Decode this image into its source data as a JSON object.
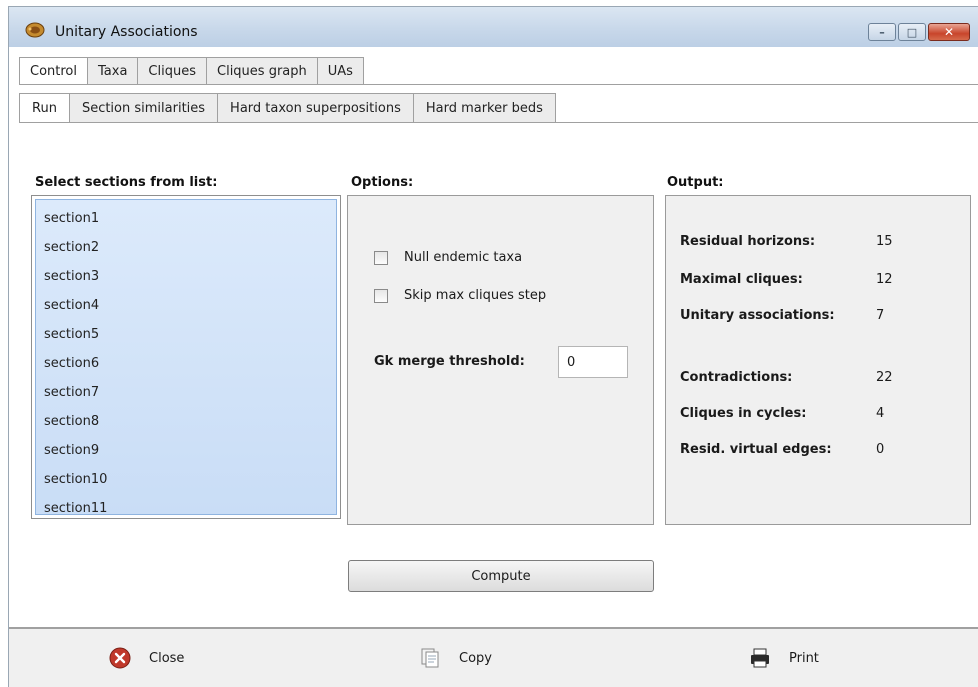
{
  "window": {
    "title": "Unitary Associations"
  },
  "tabs_top": [
    "Control",
    "Taxa",
    "Cliques",
    "Cliques graph",
    "UAs"
  ],
  "tabs_sub": [
    "Run",
    "Section similarities",
    "Hard taxon superpositions",
    "Hard marker beds"
  ],
  "sections": {
    "label": "Select sections from list:",
    "items": [
      "section1",
      "section2",
      "section3",
      "section4",
      "section5",
      "section6",
      "section7",
      "section8",
      "section9",
      "section10",
      "section11"
    ]
  },
  "options": {
    "label": "Options:",
    "null_endemic": "Null endemic taxa",
    "skip_max": "Skip max cliques step",
    "gk_label": "Gk merge threshold:",
    "gk_value": "0"
  },
  "output": {
    "label": "Output:",
    "rows": [
      {
        "label": "Residual horizons:",
        "value": "15"
      },
      {
        "label": "Maximal cliques:",
        "value": "12"
      },
      {
        "label": "Unitary associations:",
        "value": "7"
      },
      {
        "label": "Contradictions:",
        "value": "22"
      },
      {
        "label": "Cliques in cycles:",
        "value": "4"
      },
      {
        "label": "Resid. virtual edges:",
        "value": "0"
      }
    ]
  },
  "compute_label": "Compute",
  "bottom": {
    "close": "Close",
    "copy": "Copy",
    "print": "Print"
  }
}
